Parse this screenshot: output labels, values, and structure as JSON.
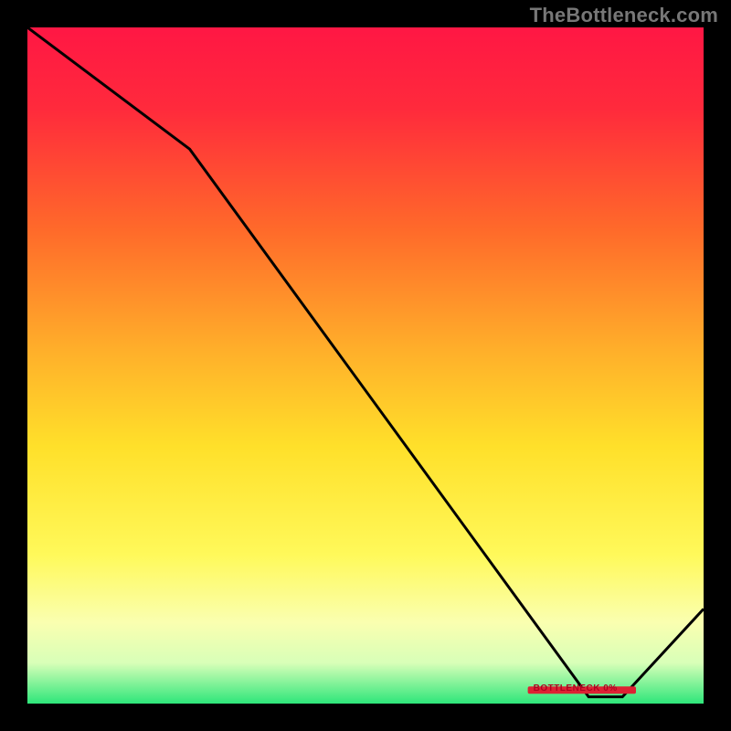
{
  "watermark": "TheBottleneck.com",
  "annotation_label": "BOTTLENECK 0%",
  "chart_data": {
    "type": "line",
    "title": "",
    "xlabel": "",
    "ylabel": "",
    "xlim": [
      0,
      100
    ],
    "ylim": [
      0,
      100
    ],
    "x": [
      0,
      24,
      83,
      88,
      100
    ],
    "values": [
      100,
      82,
      1,
      1,
      14
    ],
    "annotation_x_range": [
      74,
      90
    ],
    "annotation_y": 2,
    "gradient_stops": [
      {
        "offset": 0,
        "color": "#ff1744"
      },
      {
        "offset": 12,
        "color": "#ff2a3c"
      },
      {
        "offset": 30,
        "color": "#ff6a2a"
      },
      {
        "offset": 48,
        "color": "#ffb02a"
      },
      {
        "offset": 62,
        "color": "#ffe02a"
      },
      {
        "offset": 78,
        "color": "#fff95a"
      },
      {
        "offset": 88,
        "color": "#faffb0"
      },
      {
        "offset": 94,
        "color": "#d8ffb8"
      },
      {
        "offset": 100,
        "color": "#2ee67a"
      }
    ]
  }
}
